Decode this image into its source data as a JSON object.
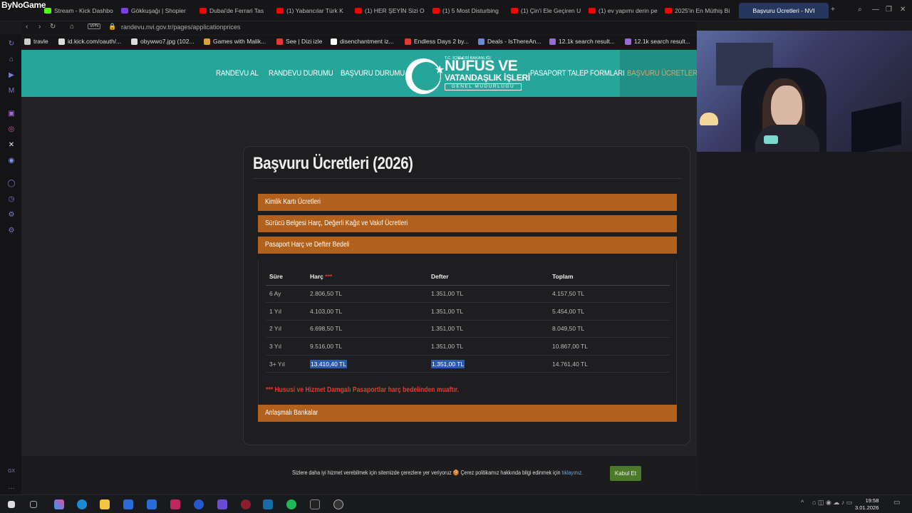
{
  "overlay_logo": "ByNoGame",
  "tabs": [
    {
      "label": "Stream - Kick Dashbo",
      "color": "#53fc18"
    },
    {
      "label": "Gökkuşağı | Shopier",
      "color": "#7b3fe4"
    },
    {
      "label": "Dubai'de Ferrari Tas",
      "color": "#ff0000"
    },
    {
      "label": "(1) Yabancılar Türk K",
      "color": "#ff0000"
    },
    {
      "label": "(1) HER ŞEYİN Sizi Ol",
      "color": "#ff0000"
    },
    {
      "label": "(1) 5 Most Disturbing",
      "color": "#ff0000"
    },
    {
      "label": "(1) Çin'i Ele Geçiren U",
      "color": "#ff0000"
    },
    {
      "label": "(1) ev yapımı derin pe",
      "color": "#ff0000"
    },
    {
      "label": "2025'in En Müthiş Bi",
      "color": "#ff0000"
    }
  ],
  "active_tab": "Başvuru Ücretleri - NVI",
  "address": {
    "vpn": "VPN",
    "url_domain": "randevu.nvi.gov.tr",
    "url_path": "/pages/applicationprices"
  },
  "bookmarks": [
    {
      "label": "travle"
    },
    {
      "label": "id.kick.com/oauth/..."
    },
    {
      "label": "obywwo7.jpg (102..."
    },
    {
      "label": "Games with Malik..."
    },
    {
      "label": "See | Dizi izle"
    },
    {
      "label": "disenchantment iz..."
    },
    {
      "label": "Endless Days 2 by..."
    },
    {
      "label": "Deals - IsThereAn..."
    },
    {
      "label": "12.1k search result..."
    },
    {
      "label": "12.1k search result..."
    }
  ],
  "site": {
    "menu": [
      "RANDEVU AL",
      "RANDEVU DURUMU",
      "BAŞVURU DURUMU",
      "PASAPORT TALEP FORMLARI",
      "BAŞVURU ÜCRETLERİ"
    ],
    "logo": {
      "small": "T.C. İÇİŞLERİ BAKANLIĞI",
      "big": "NÜFUS VE",
      "mid": "VATANDAŞLIK İŞLERİ",
      "sub": "GENEL MÜDÜRLÜĞÜ"
    },
    "accent": "#26a69a",
    "orange": "#b1611c"
  },
  "card": {
    "title": "Başvuru Ücretleri (2026)",
    "sections": [
      "Kimlik Kartı Ücretleri",
      "Sürücü Belgesi Harç, Değerli Kağıt ve Vakıf Ücretleri",
      "Pasaport Harç ve Defter Bedeli",
      "Anlaşmalı Bankalar"
    ],
    "table": {
      "headers": [
        "Süre",
        "Harç",
        "Defter",
        "Toplam"
      ],
      "harc_marker": "***",
      "rows": [
        [
          "6 Ay",
          "2.806,50 TL",
          "1.351,00 TL",
          "4.157,50 TL"
        ],
        [
          "1 Yıl",
          "4.103,00 TL",
          "1.351,00 TL",
          "5.454,00 TL"
        ],
        [
          "2 Yıl",
          "6.698,50 TL",
          "1.351,00 TL",
          "8.049,50 TL"
        ],
        [
          "3 Yıl",
          "9.516,00 TL",
          "1.351,00 TL",
          "10.867,00 TL"
        ],
        [
          "3+ Yıl",
          "13.410,40 TL",
          "1.351,00 TL",
          "14.761,40 TL"
        ]
      ]
    },
    "note_marker": "***",
    "note": "Hususi ve Hizmet Damgalı Pasaportlar harç bedelinden muaftır."
  },
  "cookie": {
    "text": "Sizlere daha iyi hizmet verebilmek için sitemizde çerezlere yer veriyoruz 🍪 Çerez politikamız hakkında bilgi edinmek için ",
    "link": "tıklayınız.",
    "button": "Kabul Et"
  },
  "clock": {
    "time": "19:58",
    "date": "3.01.2026"
  }
}
